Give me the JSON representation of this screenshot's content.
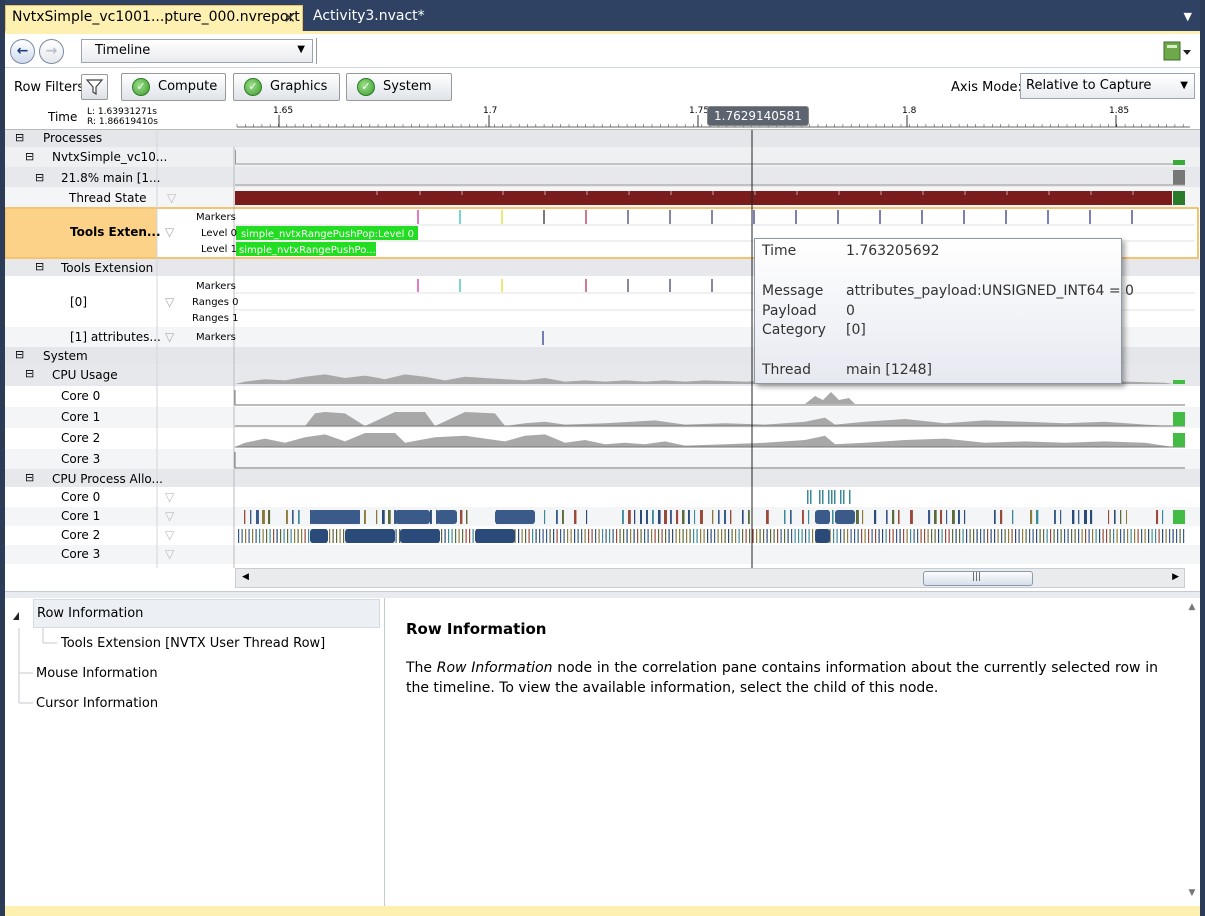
{
  "tabs": [
    {
      "label": "NvtxSimple_vc1001...pture_000.nvreport",
      "active": true
    },
    {
      "label": "Activity3.nvact*",
      "active": false
    }
  ],
  "toolbar": {
    "view_select": "Timeline"
  },
  "filters": {
    "label": "Row Filters",
    "buttons": [
      "Compute",
      "Graphics",
      "System"
    ],
    "axis_mode_label": "Axis Mode:",
    "axis_mode_value": "Relative to Capture"
  },
  "ruler": {
    "time_label": "Time",
    "left": "L: 1.63931271s",
    "right": "R: 1.86619410s",
    "ticks": [
      "1.65",
      "1.7",
      "1.75",
      "1.8",
      "1.85"
    ],
    "cursor": "1.7629140581"
  },
  "rows": {
    "processes": "Processes",
    "process_name": "NvtxSimple_vc10...",
    "thread_name": "21.8% main [1...",
    "thread_state": "Thread State",
    "tools_ext_selected": "Tools Exten...",
    "markers": "Markers",
    "level0": "Level 0",
    "level1": "Level 1",
    "range_level0": "simple_nvtxRangePushPop:Level 0",
    "range_level1": "simple_nvtxRangePushPo...",
    "tools_extension": "Tools Extension",
    "domain0": "[0]",
    "ranges0": "Ranges 0",
    "ranges1": "Ranges 1",
    "domain1": "[1]  attributes...",
    "system": "System",
    "cpu_usage": "CPU Usage",
    "cores": [
      "Core 0",
      "Core 1",
      "Core 2",
      "Core 3"
    ],
    "cpu_alloc": "CPU  Process Allo...",
    "alloc_cores": [
      "Core 0",
      "Core 1",
      "Core 2",
      "Core 3"
    ]
  },
  "tooltip": {
    "time_label": "Time",
    "time_value": "1.763205692",
    "message_label": "Message",
    "message_value": "attributes_payload:UNSIGNED_INT64 = 0",
    "payload_label": "Payload",
    "payload_value": "0",
    "category_label": "Category",
    "category_value": "[0]",
    "thread_label": "Thread",
    "thread_value": "main [1248]"
  },
  "correlation": {
    "tree": {
      "root": "Row Information",
      "child": "Tools Extension [NVTX User Thread Row]",
      "mouse": "Mouse Information",
      "cursor": "Cursor Information"
    },
    "title": "Row Information",
    "body_prefix": "The ",
    "body_em": "Row Information",
    "body_suffix": " node in the correlation pane contains information about the currently selected row in the timeline. To view the available information, select the child of this node."
  },
  "colors": {
    "thread_state": "#7a1c1c",
    "range": "#22dd22",
    "selected_row": "#fbd287",
    "accent": "#2f4263"
  }
}
